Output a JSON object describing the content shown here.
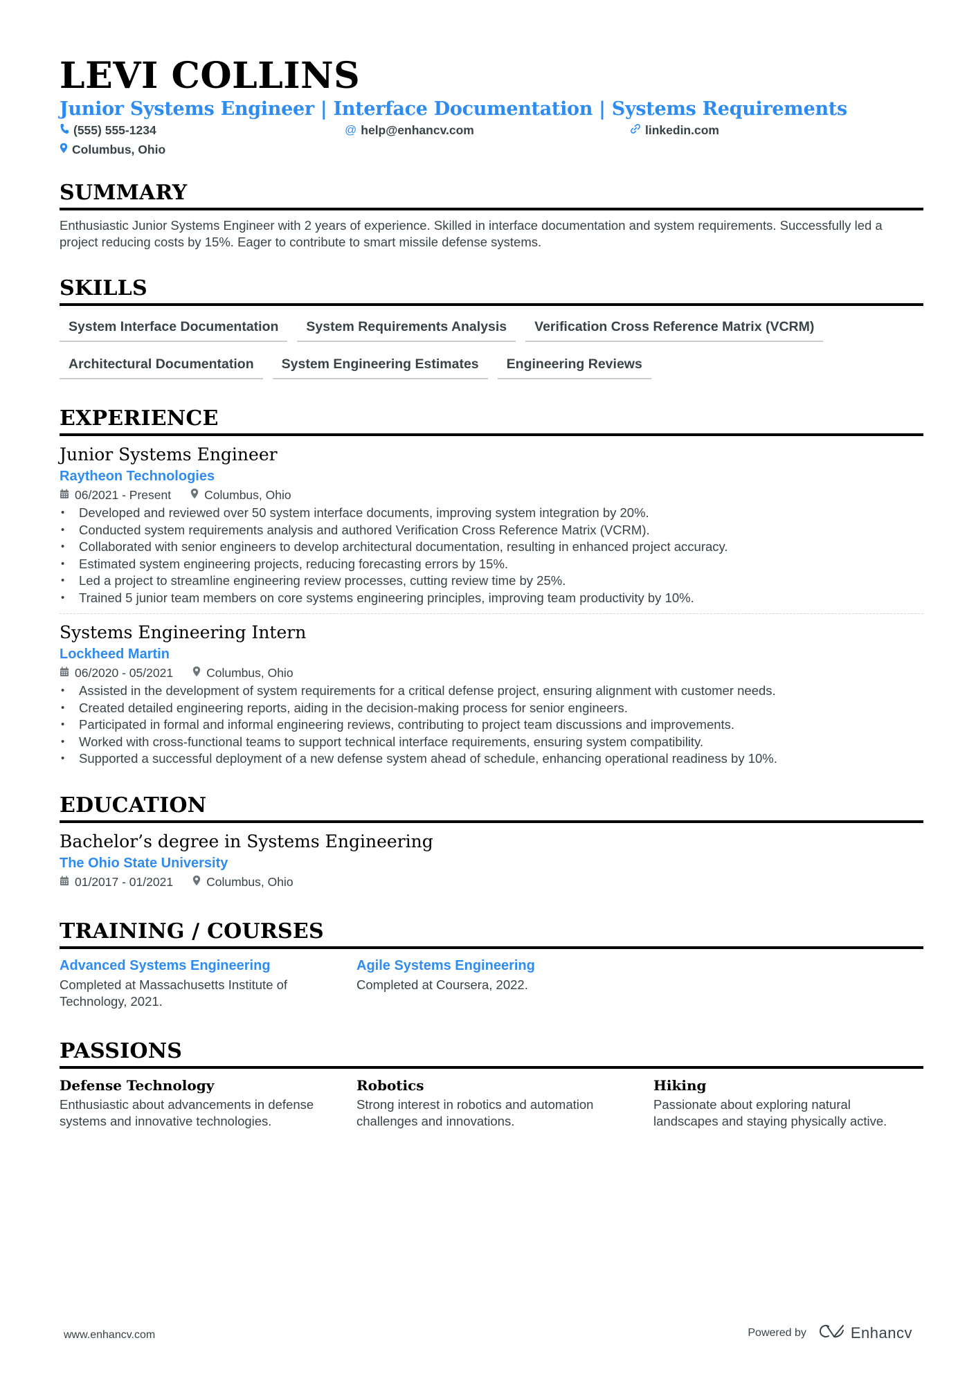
{
  "header": {
    "name": "LEVI COLLINS",
    "title": "Junior Systems Engineer | Interface Documentation | Systems Requirements",
    "contacts": [
      {
        "icon": "phone-icon",
        "text": "(555) 555-1234"
      },
      {
        "icon": "at-icon",
        "text": "help@enhancv.com"
      },
      {
        "icon": "link-icon",
        "text": "linkedin.com"
      },
      {
        "icon": "location-pin-icon",
        "text": "Columbus, Ohio"
      }
    ]
  },
  "summary": {
    "heading": "SUMMARY",
    "text": "Enthusiastic Junior Systems Engineer with 2 years of experience. Skilled in interface documentation and system requirements. Successfully led a project reducing costs by 15%. Eager to contribute to smart missile defense systems."
  },
  "skills": {
    "heading": "SKILLS",
    "items": [
      "System Interface Documentation",
      "System Requirements Analysis",
      "Verification Cross Reference Matrix (VCRM)",
      "Architectural Documentation",
      "System Engineering Estimates",
      "Engineering Reviews"
    ]
  },
  "experience": {
    "heading": "EXPERIENCE",
    "jobs": [
      {
        "role": "Junior Systems Engineer",
        "company": "Raytheon Technologies",
        "dates": "06/2021 - Present",
        "location": "Columbus, Ohio",
        "bullets": [
          "Developed and reviewed over 50 system interface documents, improving system integration by 20%.",
          "Conducted system requirements analysis and authored Verification Cross Reference Matrix (VCRM).",
          "Collaborated with senior engineers to develop architectural documentation, resulting in enhanced project accuracy.",
          "Estimated system engineering projects, reducing forecasting errors by 15%.",
          "Led a project to streamline engineering review processes, cutting review time by 25%.",
          "Trained 5 junior team members on core systems engineering principles, improving team productivity by 10%."
        ]
      },
      {
        "role": "Systems Engineering Intern",
        "company": "Lockheed Martin",
        "dates": "06/2020 - 05/2021",
        "location": "Columbus, Ohio",
        "bullets": [
          "Assisted in the development of system requirements for a critical defense project, ensuring alignment with customer needs.",
          "Created detailed engineering reports, aiding in the decision-making process for senior engineers.",
          "Participated in formal and informal engineering reviews, contributing to project team discussions and improvements.",
          "Worked with cross-functional teams to support technical interface requirements, ensuring system compatibility.",
          "Supported a successful deployment of a new defense system ahead of schedule, enhancing operational readiness by 10%."
        ]
      }
    ]
  },
  "education": {
    "heading": "EDUCATION",
    "degree": "Bachelor’s degree in Systems Engineering",
    "school": "The Ohio State University",
    "dates": "01/2017 - 01/2021",
    "location": "Columbus, Ohio"
  },
  "training": {
    "heading": "TRAINING / COURSES",
    "items": [
      {
        "title": "Advanced Systems Engineering",
        "desc": "Completed at Massachusetts Institute of Technology, 2021."
      },
      {
        "title": "Agile Systems Engineering",
        "desc": "Completed at Coursera, 2022."
      }
    ]
  },
  "passions": {
    "heading": "PASSIONS",
    "items": [
      {
        "title": "Defense Technology",
        "desc": "Enthusiastic about advancements in defense systems and innovative technologies."
      },
      {
        "title": "Robotics",
        "desc": "Strong interest in robotics and automation challenges and innovations."
      },
      {
        "title": "Hiking",
        "desc": "Passionate about exploring natural landscapes and staying physically active."
      }
    ]
  },
  "footer": {
    "website": "www.enhancv.com",
    "powered_by": "Powered by",
    "brand": "Enhancv"
  },
  "colors": {
    "accent": "#2e8cf0",
    "text": "#384347",
    "heading": "#000000"
  }
}
